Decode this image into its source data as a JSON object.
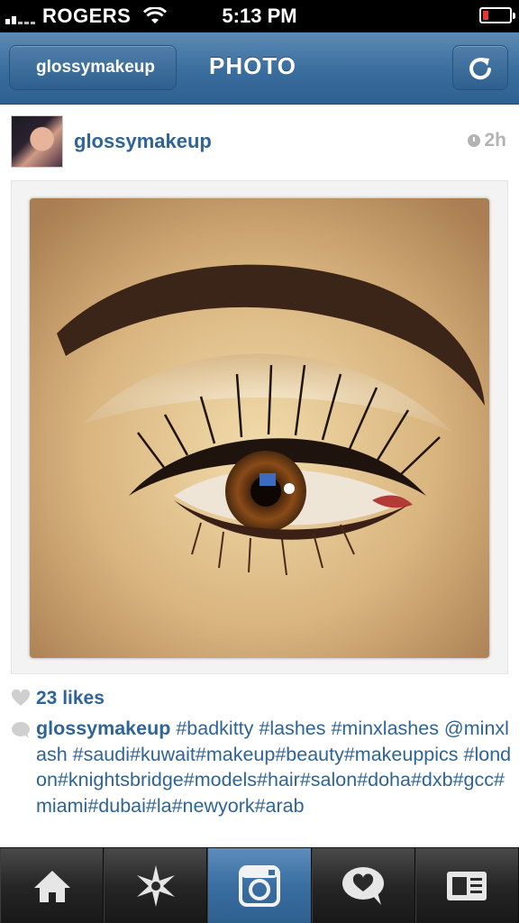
{
  "status_bar": {
    "carrier": "ROGERS",
    "time": "5:13 PM"
  },
  "nav": {
    "back_label": "glossymakeup",
    "title": "PHOTO"
  },
  "post": {
    "username": "glossymakeup",
    "timestamp": "2h",
    "photo_icon": "eye-makeup-photo",
    "likes": "23 likes",
    "caption_user": "glossymakeup",
    "caption_text": " #badkitty #lashes #minxlashes @minxlash #saudi#kuwait#makeup#beauty#makeuppics #london#knightsbridge#models#hair#salon#doha#dxb#gcc#miami#dubai#la#newyork#arab"
  },
  "tabs": [
    {
      "icon": "home-icon"
    },
    {
      "icon": "explore-star-icon"
    },
    {
      "icon": "camera-icon",
      "active": true
    },
    {
      "icon": "news-heart-bubble-icon"
    },
    {
      "icon": "profile-card-icon"
    }
  ],
  "colors": {
    "nav_blue": "#396d9d",
    "link_blue": "#2e6496",
    "tab_active": "#3a6ea1"
  }
}
